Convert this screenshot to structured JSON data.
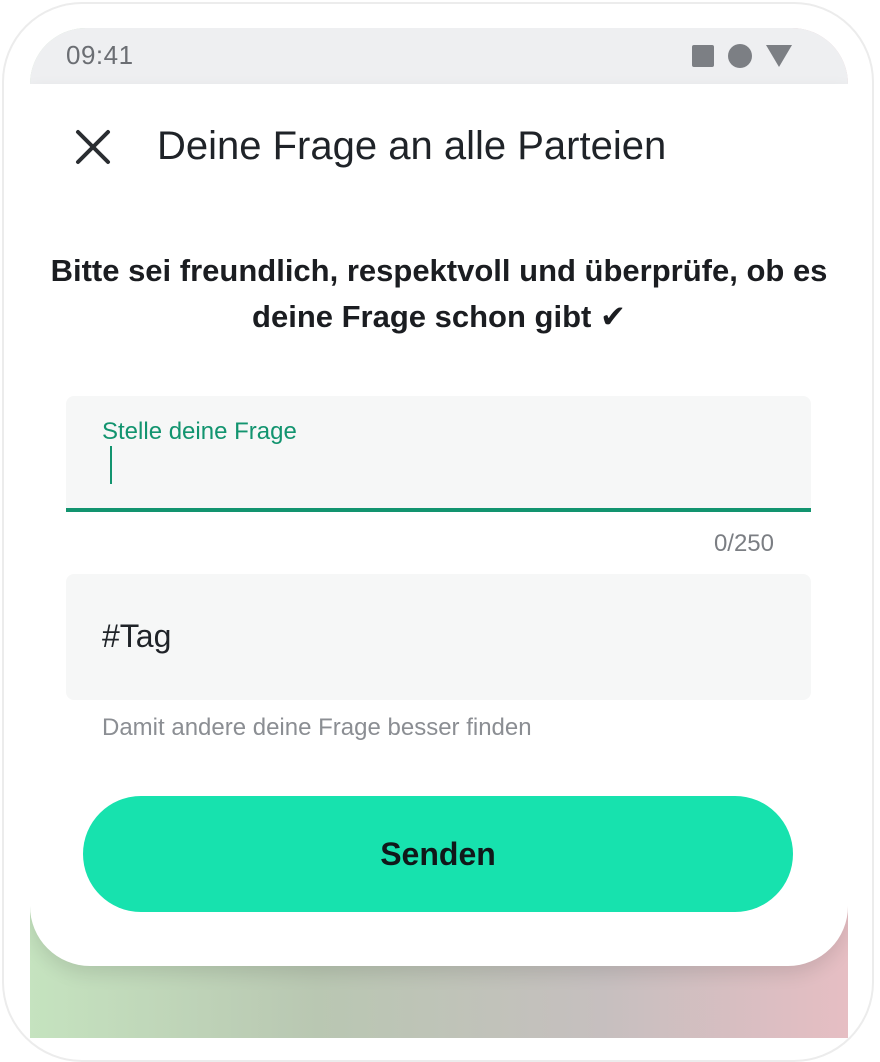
{
  "status_bar": {
    "time": "09:41",
    "icons": [
      "square-icon",
      "circle-icon",
      "triangle-icon"
    ]
  },
  "header": {
    "close_icon": "close-icon",
    "title": "Deine Frage an alle Parteien"
  },
  "hint": {
    "text": "Bitte sei freundlich, respektvoll und überprüfe, ob es deine Frage schon gibt ✔"
  },
  "question_field": {
    "label": "Stelle deine Frage",
    "value": "",
    "counter": "0/250"
  },
  "tag_field": {
    "placeholder": "#Tag",
    "value": "",
    "helper": "Damit andere deine Frage besser finden"
  },
  "actions": {
    "send_label": "Senden"
  },
  "colors": {
    "accent": "#12946f",
    "button": "#17e2ae",
    "field_bg": "#f6f7f7",
    "statusbar_bg": "#eeeff1"
  }
}
